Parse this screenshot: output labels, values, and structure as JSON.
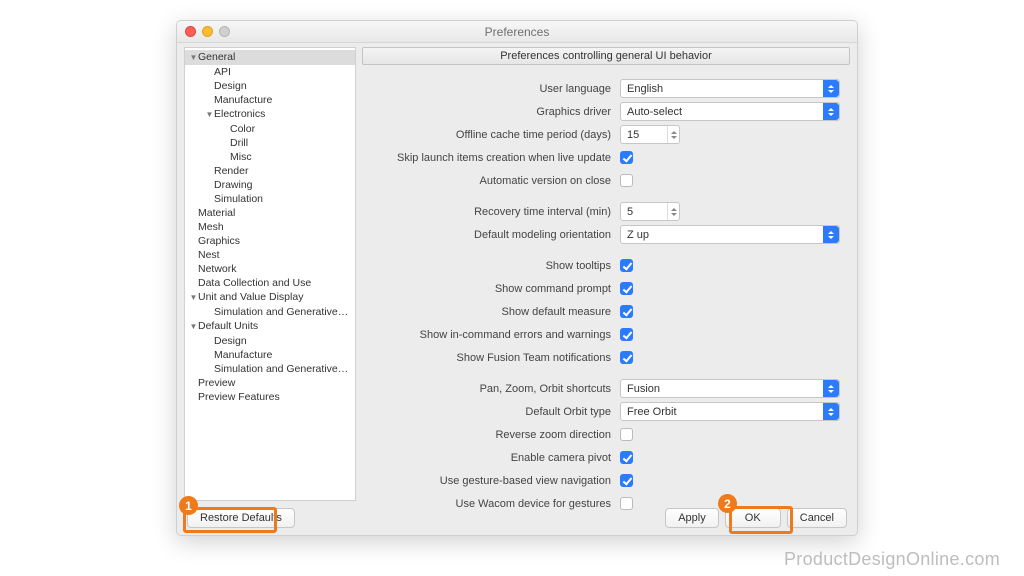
{
  "window": {
    "title": "Preferences"
  },
  "sidebar": {
    "items": [
      {
        "label": "General",
        "level": 0,
        "disclosure": "▼",
        "selected": true
      },
      {
        "label": "API",
        "level": 1
      },
      {
        "label": "Design",
        "level": 1
      },
      {
        "label": "Manufacture",
        "level": 1
      },
      {
        "label": "Electronics",
        "level": 1,
        "disclosure": "▼"
      },
      {
        "label": "Color",
        "level": 2
      },
      {
        "label": "Drill",
        "level": 2
      },
      {
        "label": "Misc",
        "level": 2
      },
      {
        "label": "Render",
        "level": 1
      },
      {
        "label": "Drawing",
        "level": 1
      },
      {
        "label": "Simulation",
        "level": 1
      },
      {
        "label": "Material",
        "level": 0
      },
      {
        "label": "Mesh",
        "level": 0
      },
      {
        "label": "Graphics",
        "level": 0
      },
      {
        "label": "Nest",
        "level": 0
      },
      {
        "label": "Network",
        "level": 0
      },
      {
        "label": "Data Collection and Use",
        "level": 0
      },
      {
        "label": "Unit and Value Display",
        "level": 0,
        "disclosure": "▼"
      },
      {
        "label": "Simulation and Generative Desi…",
        "level": 1
      },
      {
        "label": "Default Units",
        "level": 0,
        "disclosure": "▼"
      },
      {
        "label": "Design",
        "level": 1
      },
      {
        "label": "Manufacture",
        "level": 1
      },
      {
        "label": "Simulation and Generative Desi…",
        "level": 1
      },
      {
        "label": "Preview",
        "level": 0
      },
      {
        "label": "Preview Features",
        "level": 0
      }
    ]
  },
  "section_header": "Preferences controlling general UI behavior",
  "form": {
    "user_language": {
      "label": "User language",
      "value": "English"
    },
    "graphics_driver": {
      "label": "Graphics driver",
      "value": "Auto-select"
    },
    "offline_cache": {
      "label": "Offline cache time period (days)",
      "value": "15"
    },
    "skip_launch": {
      "label": "Skip launch items creation when live update",
      "checked": true
    },
    "auto_version": {
      "label": "Automatic version on close",
      "checked": false
    },
    "recovery_interval": {
      "label": "Recovery time interval (min)",
      "value": "5"
    },
    "default_orientation": {
      "label": "Default modeling orientation",
      "value": "Z up"
    },
    "show_tooltips": {
      "label": "Show tooltips",
      "checked": true
    },
    "show_cmd_prompt": {
      "label": "Show command prompt",
      "checked": true
    },
    "show_default_measure": {
      "label": "Show default measure",
      "checked": true
    },
    "show_incmd_errors": {
      "label": "Show in-command errors and warnings",
      "checked": true
    },
    "show_fusion_team": {
      "label": "Show Fusion Team notifications",
      "checked": true
    },
    "pan_zoom_orbit": {
      "label": "Pan, Zoom, Orbit shortcuts",
      "value": "Fusion"
    },
    "default_orbit": {
      "label": "Default Orbit type",
      "value": "Free Orbit"
    },
    "reverse_zoom": {
      "label": "Reverse zoom direction",
      "checked": false
    },
    "enable_cam_pivot": {
      "label": "Enable camera pivot",
      "checked": true
    },
    "gesture_nav": {
      "label": "Use gesture-based view navigation",
      "checked": true
    },
    "wacom_gestures": {
      "label": "Use Wacom device for gestures",
      "checked": false
    }
  },
  "footer": {
    "restore_defaults": "Restore Defaults",
    "apply": "Apply",
    "ok": "OK",
    "cancel": "Cancel"
  },
  "annotations": {
    "callout1": "1",
    "callout2": "2"
  },
  "watermark": "ProductDesignOnline.com"
}
